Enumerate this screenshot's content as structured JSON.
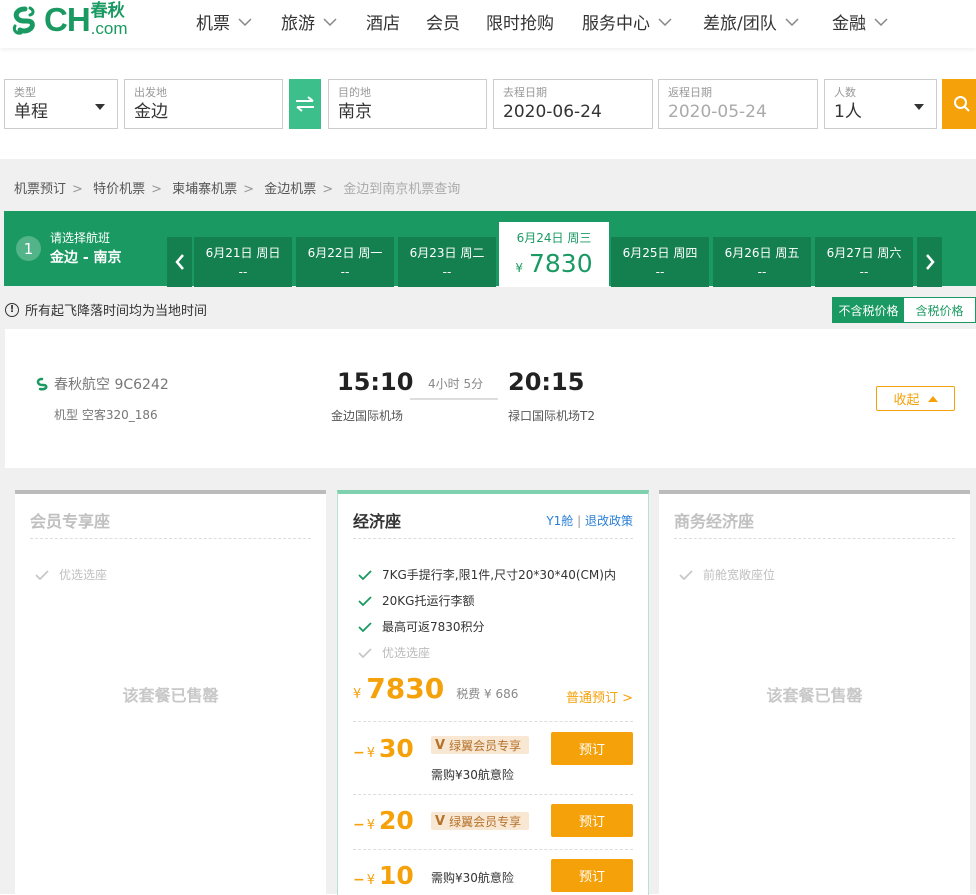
{
  "colors": {
    "brand": "#1a9a62",
    "accent": "#f5a10a",
    "link": "#2b7fd6"
  },
  "logo": {
    "latin": "CH",
    "dotcom": ".com",
    "cn": "春秋"
  },
  "nav": [
    {
      "label": "机票",
      "dropdown": true
    },
    {
      "label": "旅游",
      "dropdown": true
    },
    {
      "label": "酒店",
      "dropdown": false
    },
    {
      "label": "会员",
      "dropdown": false
    },
    {
      "label": "限时抢购",
      "dropdown": false
    },
    {
      "label": "服务中心",
      "dropdown": true
    },
    {
      "label": "差旅/团队",
      "dropdown": true
    },
    {
      "label": "金融",
      "dropdown": true
    }
  ],
  "search": {
    "type": {
      "label": "类型",
      "value": "单程"
    },
    "from": {
      "label": "出发地",
      "value": "金边"
    },
    "to": {
      "label": "目的地",
      "value": "南京"
    },
    "depart": {
      "label": "去程日期",
      "value": "2020-06-24"
    },
    "return": {
      "label": "返程日期",
      "value": "2020-05-24"
    },
    "pax": {
      "label": "人数",
      "value": "1人"
    },
    "swap_icon": "swap-arrows-icon",
    "search_icon": "search-icon"
  },
  "breadcrumb": [
    "机票预订",
    "特价机票",
    "柬埔寨机票",
    "金边机票",
    "金边到南京机票查询"
  ],
  "breadcrumb_sep": ">",
  "step": {
    "num": "1",
    "title": "请选择航班",
    "route": "金边 - 南京"
  },
  "days": [
    {
      "date": "6月21日 周日",
      "price": "--"
    },
    {
      "date": "6月22日 周一",
      "price": "--"
    },
    {
      "date": "6月23日 周二",
      "price": "--"
    },
    {
      "date": "6月24日 周三",
      "price": "7830",
      "currency": "¥",
      "selected": true
    },
    {
      "date": "6月25日 周四",
      "price": "--"
    },
    {
      "date": "6月26日 周五",
      "price": "--"
    },
    {
      "date": "6月27日 周六",
      "price": "--"
    }
  ],
  "notice": {
    "icon": "!",
    "text": "所有起飞降落时间均为当地时间"
  },
  "tax_toggle": {
    "excl": "不含税价格",
    "incl": "含税价格"
  },
  "flight": {
    "airline": "春秋航空 9C6242",
    "model": "机型 空客320_186",
    "dep_time": "15:10",
    "dep_airport": "金边国际机场",
    "duration": "4小时 5分",
    "arr_time": "20:15",
    "arr_airport": "禄口国际机场T2",
    "collapse": "收起"
  },
  "cabins": {
    "member": {
      "title": "会员专享座",
      "features": [
        "优选选座"
      ],
      "sold_out": "该套餐已售罄"
    },
    "economy": {
      "title": "经济座",
      "fare_class": "Y1舱",
      "rule_sep": "|",
      "refund_policy": "退改政策",
      "features": [
        {
          "text": "7KG手提行李,限1件,尺寸20*30*40(CM)内",
          "active": true
        },
        {
          "text": "20KG托运行李额",
          "active": true
        },
        {
          "text": "最高可返7830积分",
          "active": true
        },
        {
          "text": "优选选座",
          "active": false
        }
      ],
      "currency": "¥",
      "price": "7830",
      "tax": "税费 ¥ 686",
      "normal_book": "普通预订 >",
      "offers": [
        {
          "minus": "−",
          "currency": "¥",
          "amount": "30",
          "badge_v": "V",
          "badge": "绿翼会员专享",
          "note": "需购¥30航意险",
          "book": "预订"
        },
        {
          "minus": "−",
          "currency": "¥",
          "amount": "20",
          "badge_v": "V",
          "badge": "绿翼会员专享",
          "book": "预订"
        },
        {
          "minus": "−",
          "currency": "¥",
          "amount": "10",
          "note": "需购¥30航意险",
          "book": "预订"
        }
      ]
    },
    "business": {
      "title": "商务经济座",
      "features": [
        "前舱宽敞座位"
      ],
      "sold_out": "该套餐已售罄"
    }
  }
}
